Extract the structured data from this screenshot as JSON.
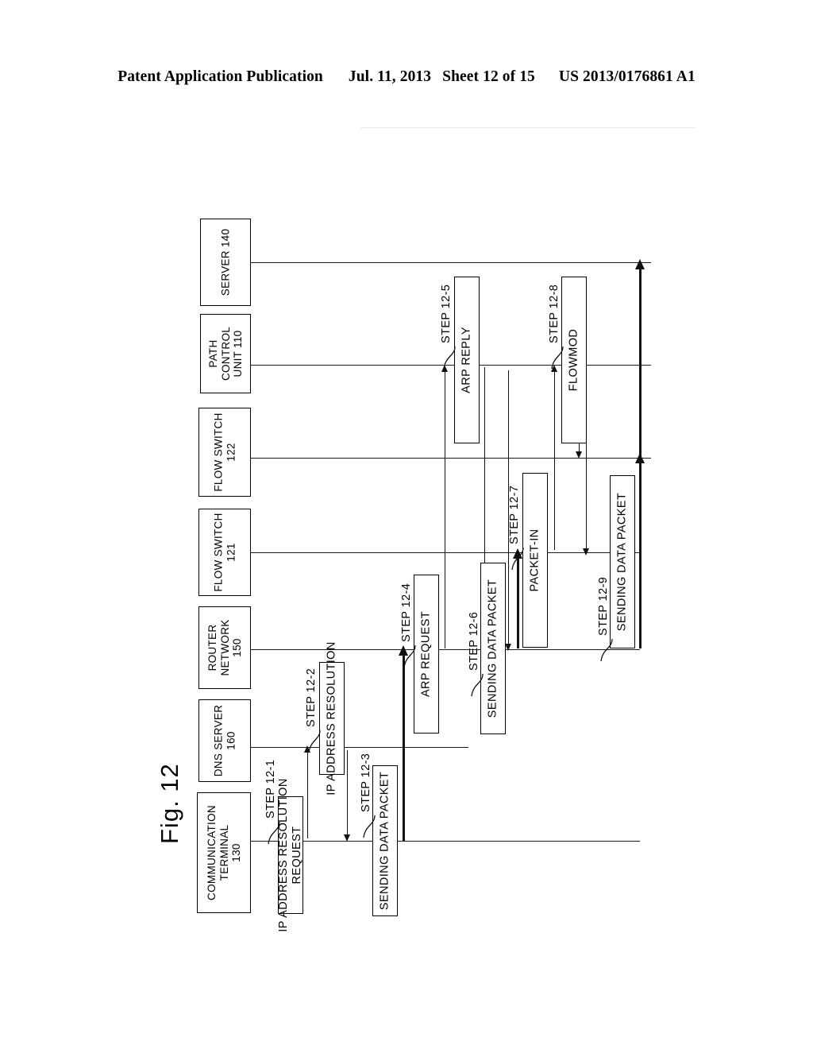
{
  "header": {
    "publication": "Patent Application Publication",
    "date": "Jul. 11, 2013",
    "sheet": "Sheet 12 of 15",
    "docnum": "US 2013/0176861 A1"
  },
  "figure": {
    "title": "Fig. 12",
    "type": "sequence-diagram",
    "orientation": "rotated-90-ccw"
  },
  "entities": [
    {
      "id": "server",
      "label": "SERVER 140",
      "lines": [
        "SERVER 140"
      ]
    },
    {
      "id": "path",
      "label": "PATH CONTROL UNIT 110",
      "lines": [
        "PATH",
        "CONTROL",
        "UNIT 110"
      ]
    },
    {
      "id": "fsw122",
      "label": "FLOW SWITCH 122",
      "lines": [
        "FLOW SWITCH",
        "122"
      ]
    },
    {
      "id": "fsw121",
      "label": "FLOW SWITCH 121",
      "lines": [
        "FLOW SWITCH",
        "121"
      ]
    },
    {
      "id": "router",
      "label": "ROUTER NETWORK 150",
      "lines": [
        "ROUTER",
        "NETWORK",
        "150"
      ]
    },
    {
      "id": "dns",
      "label": "DNS SERVER 160",
      "lines": [
        "DNS SERVER",
        "160"
      ]
    },
    {
      "id": "terminal",
      "label": "COMMUNICATION TERMINAL 130",
      "lines": [
        "COMMUNICATION",
        "TERMINAL",
        "130"
      ]
    }
  ],
  "steps": [
    {
      "id": "s1",
      "step": "STEP 12-1",
      "message": "IP ADDRESS RESOLUTION REQUEST",
      "from": "terminal",
      "to": "dns",
      "weight": "thin"
    },
    {
      "id": "s2",
      "step": "STEP 12-2",
      "message": "IP ADDRESS RESOLUTION",
      "from": "dns",
      "to": "terminal",
      "weight": "thin"
    },
    {
      "id": "s3",
      "step": "STEP 12-3",
      "message": "SENDING DATA PACKET",
      "from": "terminal",
      "to": "router",
      "weight": "thick"
    },
    {
      "id": "s4",
      "step": "STEP 12-4",
      "message": "ARP REQUEST",
      "from": "router",
      "to": "path",
      "weight": "thin"
    },
    {
      "id": "s5",
      "step": "STEP 12-5",
      "message": "ARP REPLY",
      "from": "path",
      "to": "router",
      "weight": "thin"
    },
    {
      "id": "s6",
      "step": "STEP 12-6",
      "message": "SENDING DATA PACKET",
      "from": "router",
      "to": "fsw121",
      "weight": "thick"
    },
    {
      "id": "s7",
      "step": "STEP 12-7",
      "message": "PACKET-IN",
      "from": "fsw121",
      "to": "path",
      "weight": "thin"
    },
    {
      "id": "s8",
      "step": "STEP 12-8",
      "message": "FLOWMOD",
      "from": "path",
      "to": "fsw121",
      "weight": "thin"
    },
    {
      "id": "s9",
      "step": "STEP 12-9",
      "message": "SENDING DATA PACKET",
      "from": "router",
      "to": "server",
      "weight": "thick"
    }
  ]
}
